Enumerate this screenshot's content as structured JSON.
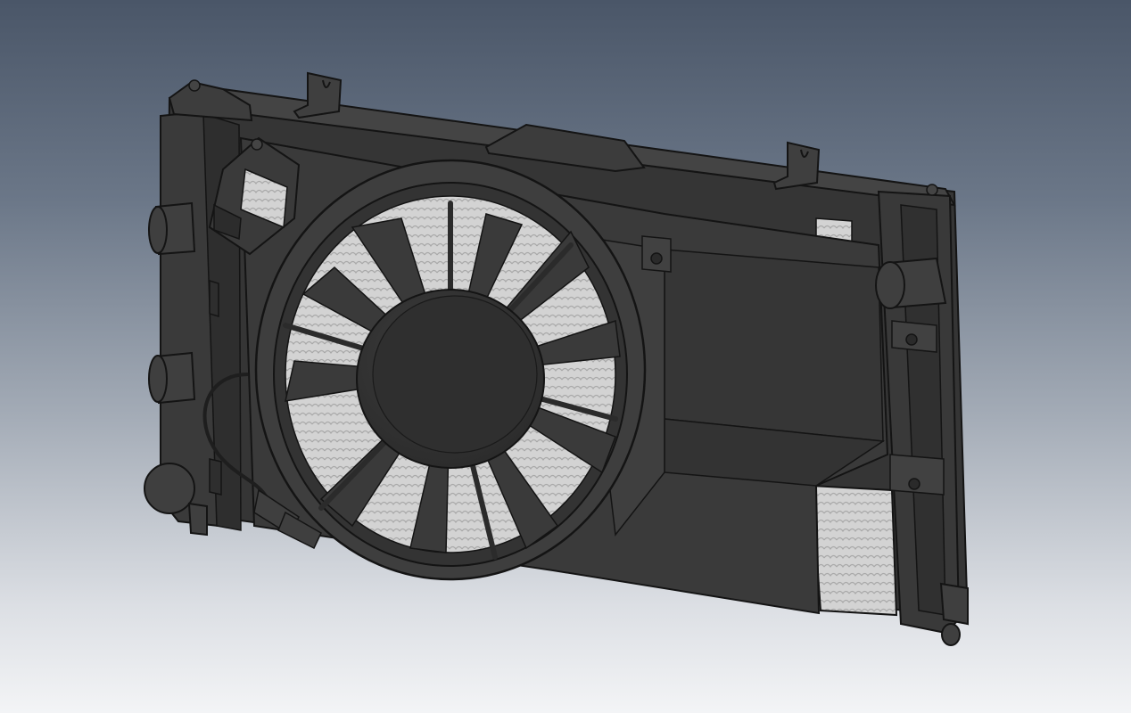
{
  "scene": {
    "model_name": "radiator-fan-assembly",
    "icon": "radiator-fan-model-icon",
    "colors": {
      "background_top": "#4a5668",
      "background_bottom": "#f3f4f6",
      "body": "#3b3b3b",
      "body_dark": "#2a2a2a",
      "body_light": "#4a4a4a",
      "edge": "#141414",
      "core_mesh": "#cfcfcf"
    }
  }
}
